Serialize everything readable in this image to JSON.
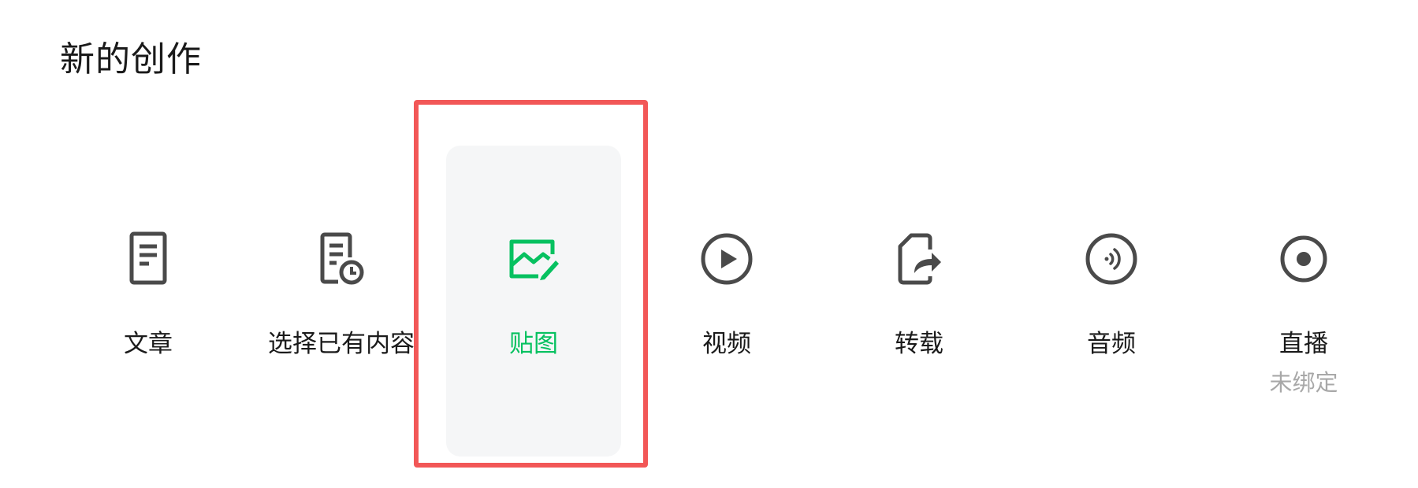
{
  "page": {
    "title": "新的创作"
  },
  "items": [
    {
      "id": "article",
      "label": "文章",
      "icon": "document-icon"
    },
    {
      "id": "select-existing",
      "label": "选择已有内容",
      "icon": "document-clock-icon"
    },
    {
      "id": "image-post",
      "label": "贴图",
      "icon": "image-icon",
      "active": true
    },
    {
      "id": "video",
      "label": "视频",
      "icon": "play-icon"
    },
    {
      "id": "repost",
      "label": "转载",
      "icon": "share-forward-icon"
    },
    {
      "id": "audio",
      "label": "音频",
      "icon": "audio-wave-icon"
    },
    {
      "id": "live",
      "label": "直播",
      "sublabel": "未绑定",
      "icon": "live-record-icon"
    }
  ],
  "colors": {
    "accent": "#07c160",
    "icon": "#4a4a4a",
    "muted": "#a8a8a8",
    "highlight": "#f25757",
    "active_bg": "#f5f6f7"
  }
}
